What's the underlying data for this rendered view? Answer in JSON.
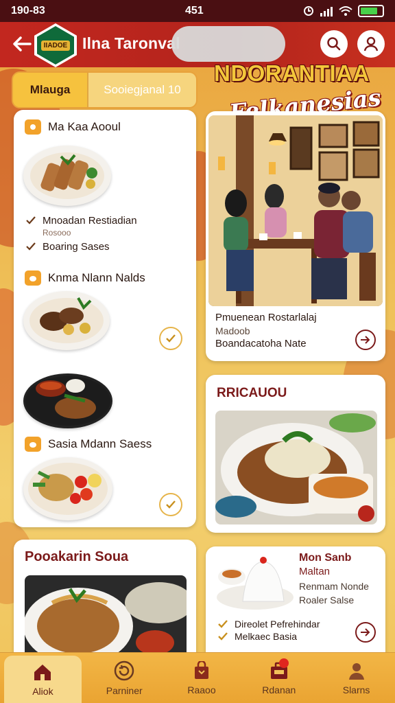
{
  "status_bar": {
    "time": "190-83",
    "center": "451"
  },
  "header": {
    "title": "Ilna Taronval",
    "logo_badge": "IIADOE"
  },
  "tabs": [
    {
      "label": "Mlauga"
    },
    {
      "label": "Sooiegjanal 10"
    }
  ],
  "promo": {
    "line1": "NDORANTIAA",
    "line2": "Felkanesias"
  },
  "menu_card": {
    "section1_title": "Ma Kaa Aooul",
    "checks1": [
      "Mnoadan Restiadian",
      "Boaring Sases"
    ],
    "subtext1": "Rosooo",
    "section2_title": "Knma Nlann Nalds",
    "section3_title": "Sasia Mdann Saess"
  },
  "restaurant": {
    "name": "Pmuenean Rostarlalaj",
    "sub": "Madoob",
    "line": "Boandacatoha Nate"
  },
  "recommendation": {
    "title": "RRICAUOU"
  },
  "popular": {
    "title": "Pooakarin Soua"
  },
  "rice_card": {
    "t1": "Mon Sanb",
    "t2": "Maltan",
    "t3": "Renmam Nonde",
    "t4": "Roaler Salse",
    "checks": [
      "Direolet Pefrehindar",
      "Melkaec Basia"
    ]
  },
  "bottom_nav": [
    {
      "label": "Aliok",
      "icon": "home-icon"
    },
    {
      "label": "Parniner",
      "icon": "refresh-icon"
    },
    {
      "label": "Raaoo",
      "icon": "bag-icon"
    },
    {
      "label": "Rdanan",
      "icon": "briefcase-icon"
    },
    {
      "label": "Slarns",
      "icon": "profile-icon"
    }
  ],
  "colors": {
    "header_red": "#c2271f",
    "accent_gold": "#f2b74a",
    "title_maroon": "#7b1a1a"
  }
}
